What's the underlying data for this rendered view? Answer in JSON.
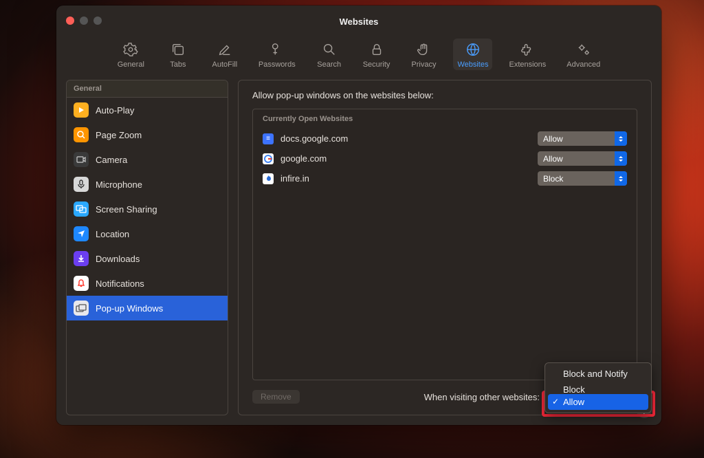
{
  "window": {
    "title": "Websites"
  },
  "toolbar": {
    "items": [
      {
        "label": "General"
      },
      {
        "label": "Tabs"
      },
      {
        "label": "AutoFill"
      },
      {
        "label": "Passwords"
      },
      {
        "label": "Search"
      },
      {
        "label": "Security"
      },
      {
        "label": "Privacy"
      },
      {
        "label": "Websites"
      },
      {
        "label": "Extensions"
      },
      {
        "label": "Advanced"
      }
    ]
  },
  "sidebar": {
    "header": "General",
    "items": [
      {
        "label": "Auto-Play"
      },
      {
        "label": "Page Zoom"
      },
      {
        "label": "Camera"
      },
      {
        "label": "Microphone"
      },
      {
        "label": "Screen Sharing"
      },
      {
        "label": "Location"
      },
      {
        "label": "Downloads"
      },
      {
        "label": "Notifications"
      },
      {
        "label": "Pop-up Windows"
      }
    ]
  },
  "main": {
    "heading": "Allow pop-up windows on the websites below:",
    "section_header": "Currently Open Websites",
    "sites": [
      {
        "name": "docs.google.com",
        "setting": "Allow"
      },
      {
        "name": "google.com",
        "setting": "Allow"
      },
      {
        "name": "infire.in",
        "setting": "Block"
      }
    ],
    "remove_label": "Remove",
    "other_sites_label": "When visiting other websites:"
  },
  "popup": {
    "items": [
      {
        "label": "Block and Notify"
      },
      {
        "label": "Block"
      },
      {
        "label": "Allow",
        "selected": true
      }
    ]
  },
  "help_label": "?"
}
